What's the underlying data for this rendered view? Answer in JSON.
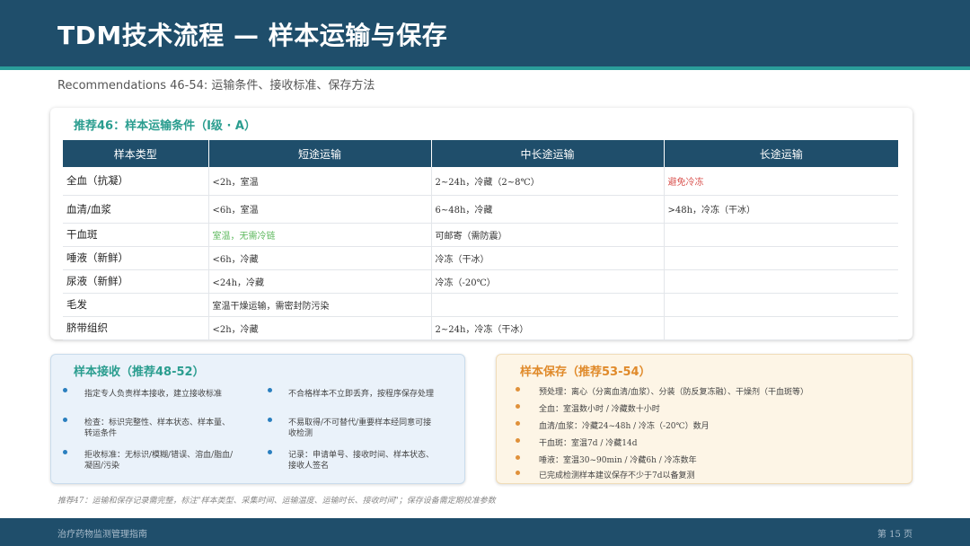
{
  "header": {
    "title": "TDM技术流程 — 样本运输与保存"
  },
  "subtitle": "Recommendations 46-54: 运输条件、接收标准、保存方法",
  "transport": {
    "title": "推荐46：样本运输条件（Ⅰ级 · A）",
    "headers": [
      "样本类型",
      "短途运输",
      "中长途运输",
      "长途运输"
    ],
    "rows": [
      [
        "全血（抗凝）",
        "<2h，室温",
        "2~24h，冷藏（2~8℃）",
        "避免冷冻"
      ],
      [
        "血清/血浆",
        "<6h，室温",
        "6~48h，冷藏",
        ">48h，冷冻（干冰）"
      ],
      [
        "干血斑",
        "室温，无需冷链",
        "可邮寄（需防震）",
        ""
      ],
      [
        "唾液（新鲜）",
        "<6h，冷藏",
        "冷冻（干冰）",
        ""
      ],
      [
        "尿液（新鲜）",
        "<24h，冷藏",
        "冷冻（-20℃）",
        ""
      ],
      [
        "毛发",
        "室温干燥运输，需密封防污染",
        "",
        ""
      ],
      [
        "脐带组织",
        "<2h，冷藏",
        "2~24h，冷冻（干冰）",
        ""
      ]
    ]
  },
  "receiving": {
    "title": "样本接收（推荐48-52）",
    "items": [
      "指定专人负责样本接收，建立接收标准",
      "不合格样本不立即丢弃，按程序保存处理",
      "检查：标识完整性、样本状态、样本量、转运条件",
      "不易取得/不可替代/重要样本经同意可接收检测",
      "拒收标准：无标识/模糊/错误、溶血/脂血/凝固/污染",
      "记录：申请单号、接收时间、样本状态、接收人签名"
    ]
  },
  "storage": {
    "title": "样本保存（推荐53-54）",
    "items": [
      "预处理：离心（分离血清/血浆）、分装（防反复冻融）、干燥剂（干血斑等）",
      "全血：室温数小时 / 冷藏数十小时",
      "血清/血浆：冷藏24~48h / 冷冻（-20℃）数月",
      "干血斑：室温7d / 冷藏14d",
      "唾液：室温30~90min / 冷藏6h / 冷冻数年",
      "已完成检测样本建议保存不少于7d以备复测"
    ]
  },
  "footnote": "推荐47：运输和保存记录需完整，标注\"样本类型、采集时间、运输温度、运输时长、接收时间\"；保存设备需定期校准参数",
  "footer": {
    "left": "治疗药物监测管理指南",
    "right": "第 15 页"
  },
  "colors": {
    "primary": "#1f4e6b",
    "accent_teal": "#2a9d8f",
    "accent_orange": "#e08a2a",
    "warning_red": "#d9534f",
    "ok_green": "#5cb85c"
  }
}
